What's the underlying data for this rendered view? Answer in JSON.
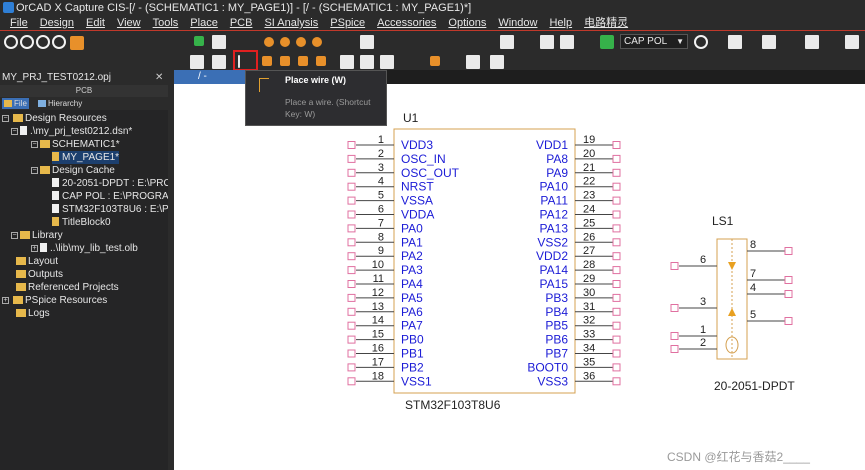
{
  "window": {
    "title": "OrCAD X Capture CIS-[/ - (SCHEMATIC1 : MY_PAGE1)] - [/ - (SCHEMATIC1 : MY_PAGE1)*]"
  },
  "menu": [
    "File",
    "Design",
    "Edit",
    "View",
    "Tools",
    "Place",
    "PCB",
    "SI Analysis",
    "PSpice",
    "Accessories",
    "Options",
    "Window",
    "Help",
    "电路精灵"
  ],
  "toolbar": {
    "part_dropdown": "CAP POL"
  },
  "project_panel": {
    "title": "MY_PRJ_TEST0212.opj",
    "subtitle": "PCB",
    "tabs": [
      "File",
      "Hierarchy"
    ],
    "tree": [
      "Design Resources",
      ".\\my_prj_test0212.dsn*",
      "SCHEMATIC1*",
      "MY_PAGE1*",
      "Design Cache",
      "20-2051-DPDT : E:\\PRO",
      "CAP POL : E:\\PROGRAM",
      "STM32F103T8U6 : E:\\PI",
      "TitleBlock0",
      "Library",
      "..\\lib\\my_lib_test.olb",
      "Layout",
      "Outputs",
      "Referenced Projects",
      "PSpice Resources",
      "Logs"
    ]
  },
  "page_tab": "/ - (SCHEMA",
  "tooltip": {
    "title": "Place wire (W)",
    "description": "Place a wire. (Shortcut Key: W)"
  },
  "u1": {
    "ref": "U1",
    "value": "STM32F103T8U6",
    "left_pins": [
      {
        "num": "1",
        "name": "VDD3"
      },
      {
        "num": "2",
        "name": "OSC_IN"
      },
      {
        "num": "3",
        "name": "OSC_OUT"
      },
      {
        "num": "4",
        "name": "NRST"
      },
      {
        "num": "5",
        "name": "VSSA"
      },
      {
        "num": "6",
        "name": "VDDA"
      },
      {
        "num": "7",
        "name": "PA0"
      },
      {
        "num": "8",
        "name": "PA1"
      },
      {
        "num": "9",
        "name": "PA2"
      },
      {
        "num": "10",
        "name": "PA3"
      },
      {
        "num": "11",
        "name": "PA4"
      },
      {
        "num": "12",
        "name": "PA5"
      },
      {
        "num": "13",
        "name": "PA6"
      },
      {
        "num": "14",
        "name": "PA7"
      },
      {
        "num": "15",
        "name": "PB0"
      },
      {
        "num": "16",
        "name": "PB1"
      },
      {
        "num": "17",
        "name": "PB2"
      },
      {
        "num": "18",
        "name": "VSS1"
      }
    ],
    "right_pins": [
      {
        "num": "19",
        "name": "VDD1"
      },
      {
        "num": "20",
        "name": "PA8"
      },
      {
        "num": "21",
        "name": "PA9"
      },
      {
        "num": "22",
        "name": "PA10"
      },
      {
        "num": "23",
        "name": "PA11"
      },
      {
        "num": "24",
        "name": "PA12"
      },
      {
        "num": "25",
        "name": "PA13"
      },
      {
        "num": "26",
        "name": "VSS2"
      },
      {
        "num": "27",
        "name": "VDD2"
      },
      {
        "num": "28",
        "name": "PA14"
      },
      {
        "num": "29",
        "name": "PA15"
      },
      {
        "num": "30",
        "name": "PB3"
      },
      {
        "num": "31",
        "name": "PB4"
      },
      {
        "num": "32",
        "name": "PB5"
      },
      {
        "num": "33",
        "name": "PB6"
      },
      {
        "num": "34",
        "name": "PB7"
      },
      {
        "num": "35",
        "name": "BOOT0"
      },
      {
        "num": "36",
        "name": "VSS3"
      }
    ]
  },
  "ls1": {
    "ref": "LS1",
    "value": "20-2051-DPDT",
    "pins": [
      "8",
      "6",
      "7",
      "4",
      "3",
      "5",
      "1",
      "2"
    ]
  },
  "watermark": "CSDN @红花与香菇2____",
  "colors": {
    "pin": "#1b1bd6",
    "body": "#d4a050",
    "pin_end": "#e070a0",
    "accent": "#3b6fb5"
  }
}
